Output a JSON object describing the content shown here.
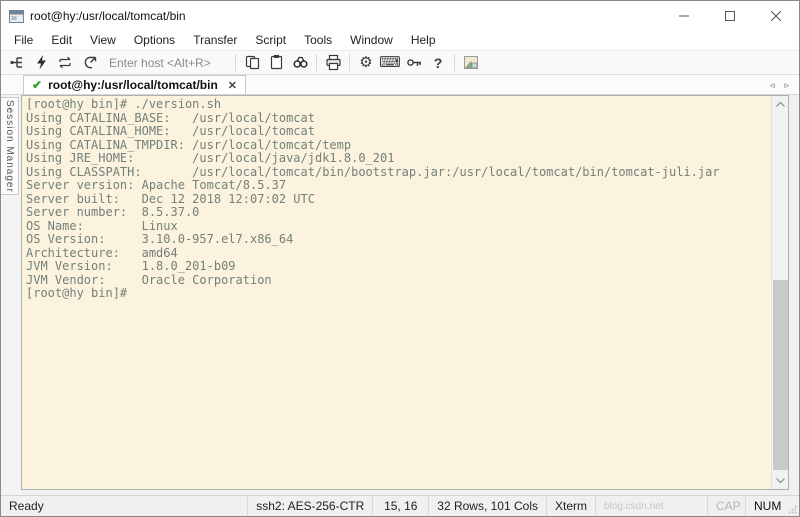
{
  "window": {
    "title": "root@hy:/usr/local/tomcat/bin"
  },
  "menu": {
    "items": [
      "File",
      "Edit",
      "View",
      "Options",
      "Transfer",
      "Script",
      "Tools",
      "Window",
      "Help"
    ]
  },
  "toolbar": {
    "host_placeholder": "Enter host <Alt+R>",
    "help_label": "?",
    "icons": [
      "session-manager",
      "quick-connect",
      "reconnect",
      "disconnect",
      "copy",
      "paste",
      "find",
      "print",
      "options-gear",
      "keymap",
      "key",
      "help",
      "screen-capture"
    ]
  },
  "tabbar": {
    "active_tab": {
      "label": "root@hy:/usr/local/tomcat/bin",
      "status_icon": "connected-check",
      "close": "✕"
    },
    "scroll_left": "◃",
    "scroll_right": "▹"
  },
  "sidebar": {
    "label": "Session Manager"
  },
  "terminal": {
    "lines": [
      "[root@hy bin]# ./version.sh",
      "Using CATALINA_BASE:   /usr/local/tomcat",
      "Using CATALINA_HOME:   /usr/local/tomcat",
      "Using CATALINA_TMPDIR: /usr/local/tomcat/temp",
      "Using JRE_HOME:        /usr/local/java/jdk1.8.0_201",
      "Using CLASSPATH:       /usr/local/tomcat/bin/bootstrap.jar:/usr/local/tomcat/bin/tomcat-juli.jar",
      "Server version: Apache Tomcat/8.5.37",
      "Server built:   Dec 12 2018 12:07:02 UTC",
      "Server number:  8.5.37.0",
      "OS Name:        Linux",
      "OS Version:     3.10.0-957.el7.x86_64",
      "Architecture:   amd64",
      "JVM Version:    1.8.0_201-b09",
      "JVM Vendor:     Oracle Corporation",
      "[root@hy bin]# "
    ]
  },
  "statusbar": {
    "status": "Ready",
    "protocol": "ssh2: AES-256-CTR",
    "cursor_position": "15, 16",
    "screen_size": "32 Rows, 101 Cols",
    "emulation": "Xterm",
    "watermark": "blog.csdn.net",
    "caps_indicator": "CAP",
    "num_indicator": "NUM"
  },
  "colors": {
    "terminal_background": "#fcf3de",
    "terminal_text": "#73817a",
    "connected_check_green": "#2fa42b"
  }
}
